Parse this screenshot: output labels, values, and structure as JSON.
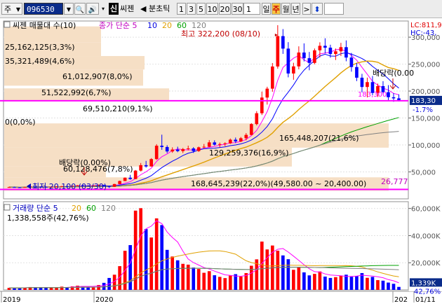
{
  "toolbar": {
    "market_select": "주",
    "stock_code": "096530",
    "stock_name_icon": "Y",
    "mode_button": "신",
    "stock_name": "씨젠",
    "interval_label": "◀ 분초틱",
    "period_buttons": [
      "1",
      "3",
      "5",
      "10",
      "20",
      "30"
    ],
    "count_value": "1",
    "timeframes": [
      "일",
      "주",
      "월",
      "년"
    ],
    "active_timeframe": "주",
    "next_arrow": ">",
    "updown_arrow": "⬍"
  },
  "price_panel": {
    "title": "씨젠 매물대 수(10)",
    "ma_label": "종가 단순 5",
    "ma_periods": [
      "10",
      "20",
      "60",
      "120"
    ],
    "high_label": "최고 322,200 (08/10)",
    "low_label": "최저 20,100 (03/30)",
    "dividend_label_right": "배당락(0.00",
    "dividend_label_left": "배당락(0.00%)",
    "lc_label": "LC:811,9",
    "hc_label": "HC:-43,",
    "current_price": "183,30",
    "change_pct": "-1.7%",
    "volume_profile_labels": [
      "25,162,125(3,3%)",
      "35,321,489(4,6%)",
      "61,012,907(8,0%)",
      "51,522,992(6,7%)",
      "69,510,210(9,1%)",
      "0(0,0%)",
      "165,448,207(21,6%)",
      "129,259,376(16,9%)",
      "60,128,476(7,8%)",
      "168,645,239(22,0%)(49,580.00 ~ 20,400.00)"
    ],
    "bottom_right_value": "26,777",
    "box_level_label": "183,300",
    "y_ticks": [
      "300,000",
      "250,000",
      "200,000",
      "150,000",
      "100,000",
      "50,000"
    ]
  },
  "volume_panel": {
    "title": "거래량 단순 5",
    "ma_periods": [
      "20",
      "60",
      "120"
    ],
    "current_volume": "1,338,558주(42,76%)",
    "side_volume": "1,339K",
    "side_pct": "42,76%",
    "y_ticks": [
      "60,000K",
      "40,000K",
      "20,000K"
    ]
  },
  "x_axis": {
    "labels": [
      "2019",
      "2020",
      "202",
      "01/11"
    ]
  },
  "colors": {
    "up_candle": "#ff0000",
    "down_candle": "#0000ff",
    "magenta_line": "#ff00ff",
    "ma5": "#ff00ff",
    "ma10": "#0000ff",
    "ma20": "#e0a000",
    "ma60": "#00a000",
    "ma120": "#808080",
    "profile_fill": "#f6dfc5"
  },
  "chart_data": {
    "type": "candlestick",
    "note_series": "weekly candles (open, high, low, close) in KRW",
    "candles": [
      [
        21500,
        22500,
        20800,
        21900
      ],
      [
        21900,
        22600,
        21200,
        21500
      ],
      [
        21500,
        22000,
        20600,
        21000
      ],
      [
        21000,
        22300,
        20900,
        22000
      ],
      [
        22000,
        23500,
        21800,
        23000
      ],
      [
        23000,
        23400,
        22100,
        22600
      ],
      [
        22600,
        23100,
        21900,
        22300
      ],
      [
        22300,
        22800,
        21500,
        21800
      ],
      [
        21800,
        22400,
        21300,
        22100
      ],
      [
        22100,
        23200,
        21900,
        22900
      ],
      [
        22900,
        24000,
        22500,
        23600
      ],
      [
        23600,
        24200,
        22800,
        23100
      ],
      [
        23100,
        24500,
        22900,
        24200
      ],
      [
        24200,
        25600,
        23900,
        25100
      ],
      [
        25100,
        25900,
        24300,
        24700
      ],
      [
        24700,
        25200,
        23600,
        24000
      ],
      [
        24000,
        25100,
        23800,
        24800
      ],
      [
        24800,
        26500,
        24500,
        25600
      ],
      [
        25600,
        26200,
        22800,
        23200
      ],
      [
        23200,
        24000,
        20100,
        22400
      ],
      [
        22400,
        28000,
        22200,
        27500
      ],
      [
        27500,
        33800,
        27000,
        33100
      ],
      [
        33100,
        39800,
        32800,
        39200
      ],
      [
        39200,
        44500,
        35500,
        36800
      ],
      [
        36800,
        53500,
        36500,
        52400
      ],
      [
        52400,
        66600,
        50800,
        62500
      ],
      [
        62500,
        70500,
        58000,
        60200
      ],
      [
        60200,
        75600,
        59600,
        73800
      ],
      [
        73800,
        101500,
        72500,
        98600
      ],
      [
        98600,
        119100,
        91000,
        96200
      ],
      [
        96200,
        99500,
        84800,
        88000
      ],
      [
        88000,
        95600,
        85500,
        91500
      ],
      [
        91500,
        96800,
        86600,
        88600
      ],
      [
        88600,
        94500,
        85000,
        92400
      ],
      [
        92400,
        98700,
        90100,
        93600
      ],
      [
        93600,
        96000,
        85200,
        88800
      ],
      [
        88800,
        97000,
        87200,
        95600
      ],
      [
        95600,
        101800,
        93800,
        96700
      ],
      [
        96700,
        109000,
        95900,
        104800
      ],
      [
        104800,
        108600,
        98800,
        100500
      ],
      [
        100500,
        104500,
        95500,
        101600
      ],
      [
        101600,
        105000,
        97800,
        103000
      ],
      [
        103000,
        112000,
        101800,
        109800
      ],
      [
        109800,
        113800,
        103500,
        106600
      ],
      [
        106600,
        114800,
        105200,
        112500
      ],
      [
        112500,
        122000,
        108600,
        118700
      ],
      [
        118700,
        140500,
        117900,
        138800
      ],
      [
        138800,
        162800,
        136400,
        158900
      ],
      [
        158900,
        199000,
        155600,
        188000
      ],
      [
        188000,
        208000,
        175000,
        204500
      ],
      [
        204500,
        252000,
        198700,
        245600
      ],
      [
        245600,
        322200,
        241500,
        302000
      ],
      [
        302000,
        315000,
        269000,
        278800
      ],
      [
        278800,
        290800,
        225500,
        232600
      ],
      [
        232600,
        252500,
        221000,
        245800
      ],
      [
        245800,
        283000,
        240300,
        271500
      ],
      [
        271500,
        288500,
        255000,
        261000
      ],
      [
        261000,
        272600,
        238600,
        252300
      ],
      [
        252300,
        279000,
        249700,
        275600
      ],
      [
        275600,
        290500,
        262300,
        284000
      ],
      [
        284000,
        298000,
        270000,
        280500
      ],
      [
        280500,
        286000,
        262000,
        268800
      ],
      [
        268800,
        279000,
        257600,
        273800
      ],
      [
        273800,
        289500,
        265100,
        281500
      ],
      [
        281500,
        294000,
        255300,
        262200
      ],
      [
        262200,
        270800,
        236000,
        244600
      ],
      [
        244600,
        252000,
        218500,
        224800
      ],
      [
        224800,
        232000,
        197500,
        207600
      ],
      [
        207600,
        225000,
        188200,
        216600
      ],
      [
        216600,
        228000,
        192300,
        196500
      ],
      [
        196500,
        214000,
        189000,
        209200
      ],
      [
        209200,
        218400,
        194000,
        198000
      ],
      [
        198000,
        211000,
        182500,
        188600
      ],
      [
        188600,
        196300,
        180100,
        186500
      ],
      [
        186500,
        193800,
        180800,
        183300
      ]
    ],
    "volumes_thousand_shares": [
      1500,
      1300,
      1600,
      1800,
      2100,
      1900,
      1700,
      1600,
      1500,
      1800,
      2400,
      2000,
      2600,
      3100,
      2800,
      2500,
      2200,
      3600,
      5200,
      8800,
      11200,
      17500,
      28800,
      33000,
      58400,
      60200,
      44800,
      38600,
      52700,
      47800,
      29500,
      24600,
      21800,
      19200,
      18600,
      16500,
      15400,
      12600,
      13800,
      10800,
      9600,
      8700,
      10500,
      11600,
      9800,
      12400,
      17800,
      22500,
      35600,
      29800,
      32700,
      28900,
      25400,
      22600,
      14800,
      16800,
      12900,
      10700,
      11800,
      13600,
      9800,
      8800,
      9400,
      10600,
      11200,
      9700,
      10300,
      12400,
      8900,
      9600,
      7200,
      6800,
      5400,
      4500,
      2200
    ],
    "ylim_price": [
      0,
      330000
    ],
    "ylim_volume": [
      0,
      65000
    ],
    "xlabels": [
      "2019",
      "2020",
      "202",
      "01/11"
    ]
  }
}
